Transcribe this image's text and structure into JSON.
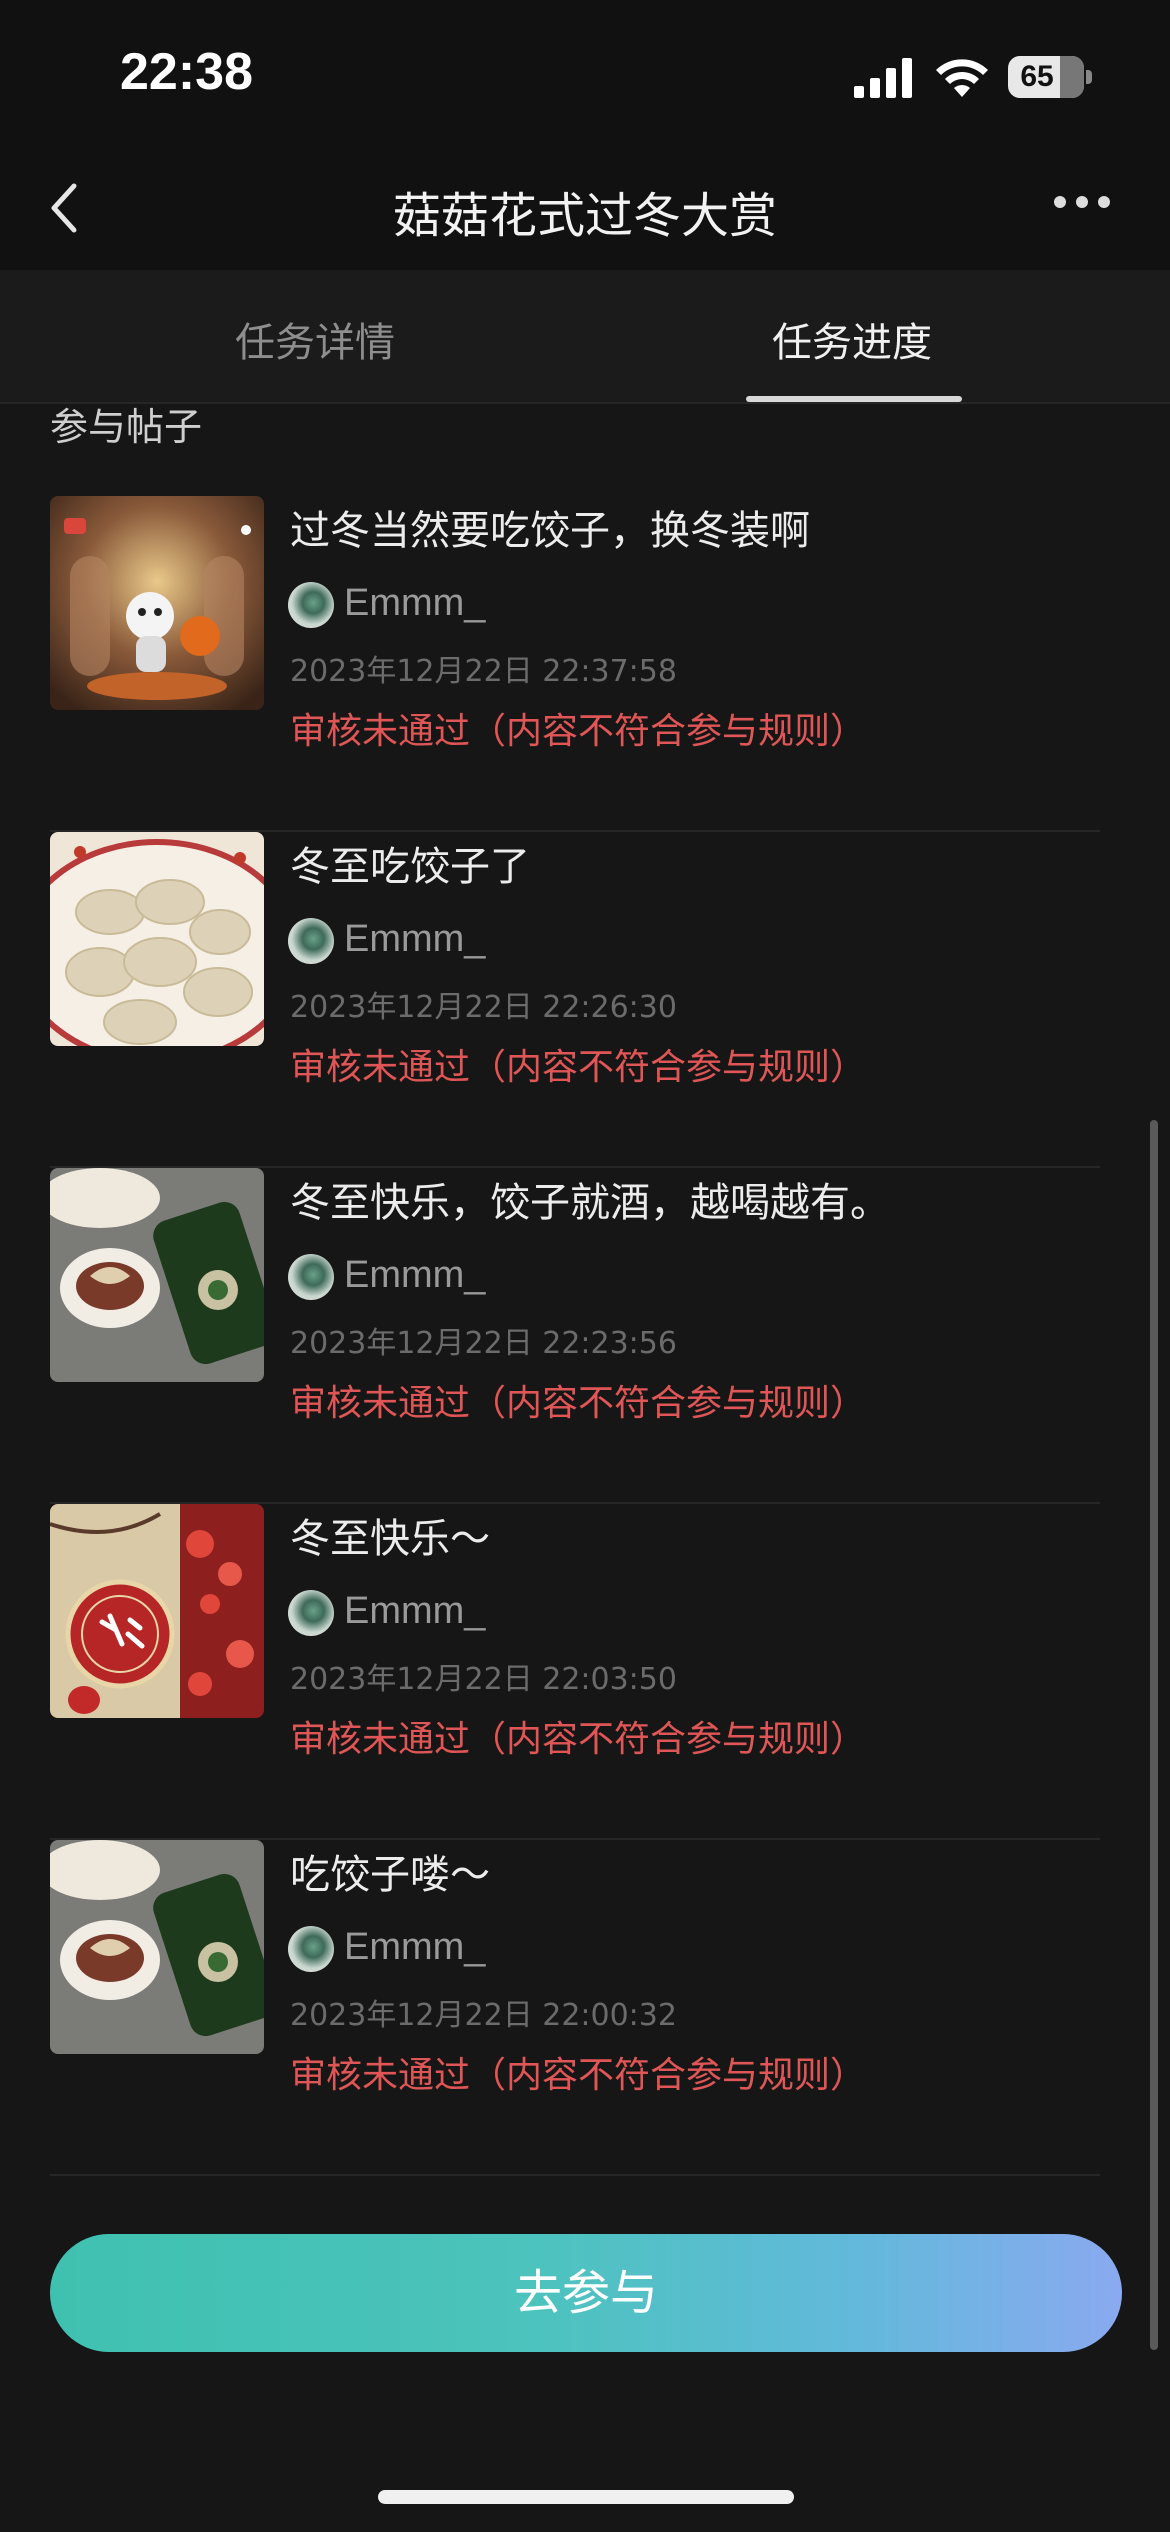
{
  "status_bar": {
    "time": "22:38",
    "battery": "65"
  },
  "nav": {
    "title": "菇菇花式过冬大赏"
  },
  "tabs": [
    {
      "label": "任务详情",
      "active": false
    },
    {
      "label": "任务进度",
      "active": true
    }
  ],
  "section_title": "参与帖子",
  "posts": [
    {
      "title": "过冬当然要吃饺子，换冬装啊",
      "user": "Emmm_",
      "date": "2023年12月22日 22:37:58",
      "status": "审核未通过（内容不符合参与规则）",
      "thumb": "cartoon-character-dumpling"
    },
    {
      "title": "冬至吃饺子了",
      "user": "Emmm_",
      "date": "2023年12月22日 22:26:30",
      "status": "审核未通过（内容不符合参与规则）",
      "thumb": "plate-of-dumplings"
    },
    {
      "title": "冬至快乐，饺子就酒，越喝越有。",
      "user": "Emmm_",
      "date": "2023年12月22日 22:23:56",
      "status": "审核未通过（内容不符合参与规则）",
      "thumb": "dumplings-and-bottle"
    },
    {
      "title": "冬至快乐～",
      "user": "Emmm_",
      "date": "2023年12月22日 22:03:50",
      "status": "审核未通过（内容不符合参与规则）",
      "thumb": "winter-solstice-card"
    },
    {
      "title": "吃饺子喽～",
      "user": "Emmm_",
      "date": "2023年12月22日 22:00:32",
      "status": "审核未通过（内容不符合参与规则）",
      "thumb": "dumplings-and-bottle"
    }
  ],
  "join_button": "去参与",
  "colors": {
    "status_red": "#e05656",
    "button_start": "#3fc1b0",
    "button_end": "#8aa9f0",
    "background": "#161616"
  }
}
